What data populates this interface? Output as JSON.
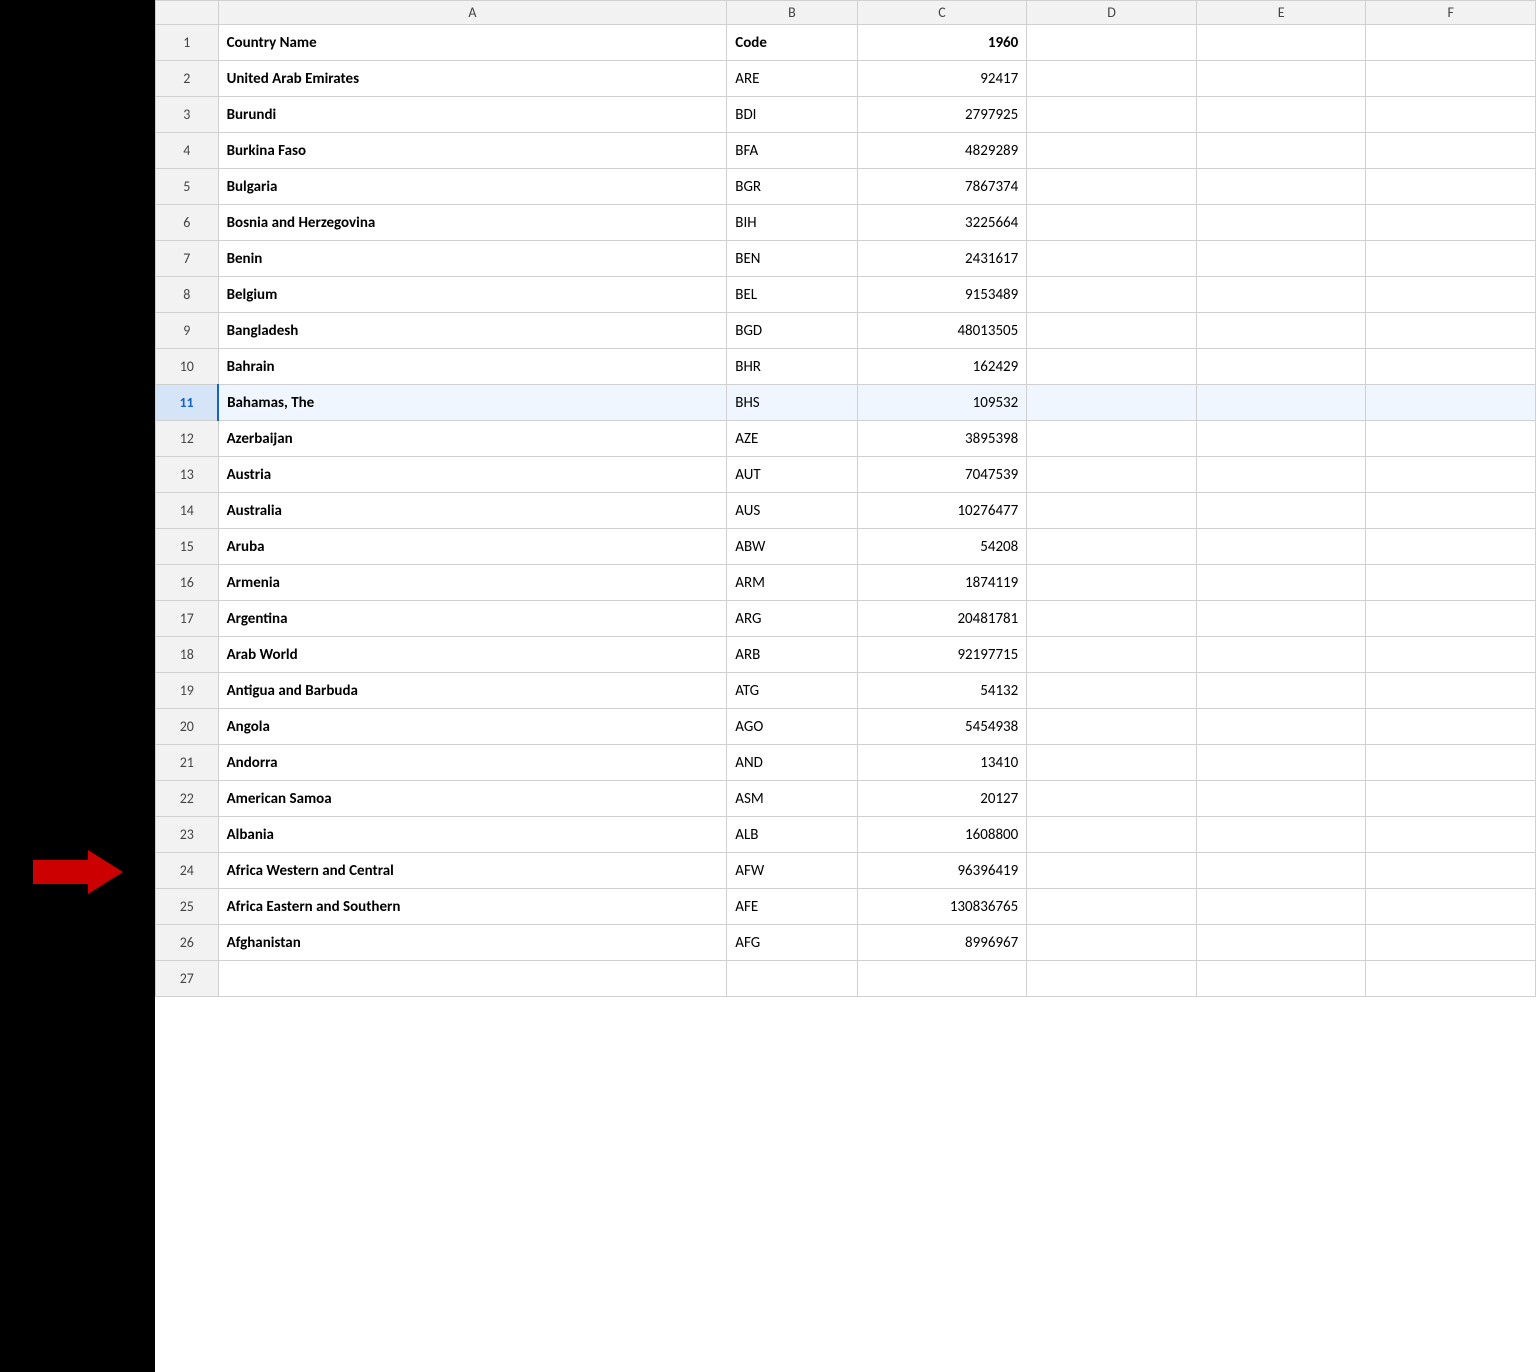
{
  "spreadsheet": {
    "columns": {
      "row_indicator": "",
      "A": "A",
      "B": "B",
      "C": "C",
      "D": "D",
      "E": "E",
      "F": "F"
    },
    "rows": [
      {
        "row_num": "1",
        "A": "Country Name",
        "B": "Code",
        "C": "1960",
        "D": "",
        "E": "",
        "F": "",
        "is_header": true
      },
      {
        "row_num": "2",
        "A": "United Arab Emirates",
        "B": "ARE",
        "C": "92417",
        "D": "",
        "E": "",
        "F": ""
      },
      {
        "row_num": "3",
        "A": "Burundi",
        "B": "BDI",
        "C": "2797925",
        "D": "",
        "E": "",
        "F": ""
      },
      {
        "row_num": "4",
        "A": "Burkina Faso",
        "B": "BFA",
        "C": "4829289",
        "D": "",
        "E": "",
        "F": ""
      },
      {
        "row_num": "5",
        "A": "Bulgaria",
        "B": "BGR",
        "C": "7867374",
        "D": "",
        "E": "",
        "F": ""
      },
      {
        "row_num": "6",
        "A": "Bosnia and Herzegovina",
        "B": "BIH",
        "C": "3225664",
        "D": "",
        "E": "",
        "F": ""
      },
      {
        "row_num": "7",
        "A": "Benin",
        "B": "BEN",
        "C": "2431617",
        "D": "",
        "E": "",
        "F": ""
      },
      {
        "row_num": "8",
        "A": "Belgium",
        "B": "BEL",
        "C": "9153489",
        "D": "",
        "E": "",
        "F": ""
      },
      {
        "row_num": "9",
        "A": "Bangladesh",
        "B": "BGD",
        "C": "48013505",
        "D": "",
        "E": "",
        "F": ""
      },
      {
        "row_num": "10",
        "A": "Bahrain",
        "B": "BHR",
        "C": "162429",
        "D": "",
        "E": "",
        "F": ""
      },
      {
        "row_num": "11",
        "A": "Bahamas, The",
        "B": "BHS",
        "C": "109532",
        "D": "",
        "E": "",
        "F": "",
        "is_selected": true
      },
      {
        "row_num": "12",
        "A": "Azerbaijan",
        "B": "AZE",
        "C": "3895398",
        "D": "",
        "E": "",
        "F": ""
      },
      {
        "row_num": "13",
        "A": "Austria",
        "B": "AUT",
        "C": "7047539",
        "D": "",
        "E": "",
        "F": ""
      },
      {
        "row_num": "14",
        "A": "Australia",
        "B": "AUS",
        "C": "10276477",
        "D": "",
        "E": "",
        "F": ""
      },
      {
        "row_num": "15",
        "A": "Aruba",
        "B": "ABW",
        "C": "54208",
        "D": "",
        "E": "",
        "F": ""
      },
      {
        "row_num": "16",
        "A": "Armenia",
        "B": "ARM",
        "C": "1874119",
        "D": "",
        "E": "",
        "F": ""
      },
      {
        "row_num": "17",
        "A": "Argentina",
        "B": "ARG",
        "C": "20481781",
        "D": "",
        "E": "",
        "F": ""
      },
      {
        "row_num": "18",
        "A": "Arab World",
        "B": "ARB",
        "C": "92197715",
        "D": "",
        "E": "",
        "F": ""
      },
      {
        "row_num": "19",
        "A": "Antigua and Barbuda",
        "B": "ATG",
        "C": "54132",
        "D": "",
        "E": "",
        "F": ""
      },
      {
        "row_num": "20",
        "A": "Angola",
        "B": "AGO",
        "C": "5454938",
        "D": "",
        "E": "",
        "F": ""
      },
      {
        "row_num": "21",
        "A": "Andorra",
        "B": "AND",
        "C": "13410",
        "D": "",
        "E": "",
        "F": ""
      },
      {
        "row_num": "22",
        "A": "American Samoa",
        "B": "ASM",
        "C": "20127",
        "D": "",
        "E": "",
        "F": ""
      },
      {
        "row_num": "23",
        "A": "Albania",
        "B": "ALB",
        "C": "1608800",
        "D": "",
        "E": "",
        "F": ""
      },
      {
        "row_num": "24",
        "A": "Africa Western and Central",
        "B": "AFW",
        "C": "96396419",
        "D": "",
        "E": "",
        "F": ""
      },
      {
        "row_num": "25",
        "A": "Africa Eastern and Southern",
        "B": "AFE",
        "C": "130836765",
        "D": "",
        "E": "",
        "F": ""
      },
      {
        "row_num": "26",
        "A": "Afghanistan",
        "B": "AFG",
        "C": "8996967",
        "D": "",
        "E": "",
        "F": ""
      },
      {
        "row_num": "27",
        "A": "",
        "B": "",
        "C": "",
        "D": "",
        "E": "",
        "F": ""
      }
    ]
  },
  "arrow": {
    "label": "red arrow pointing right",
    "color": "#cc0000"
  }
}
